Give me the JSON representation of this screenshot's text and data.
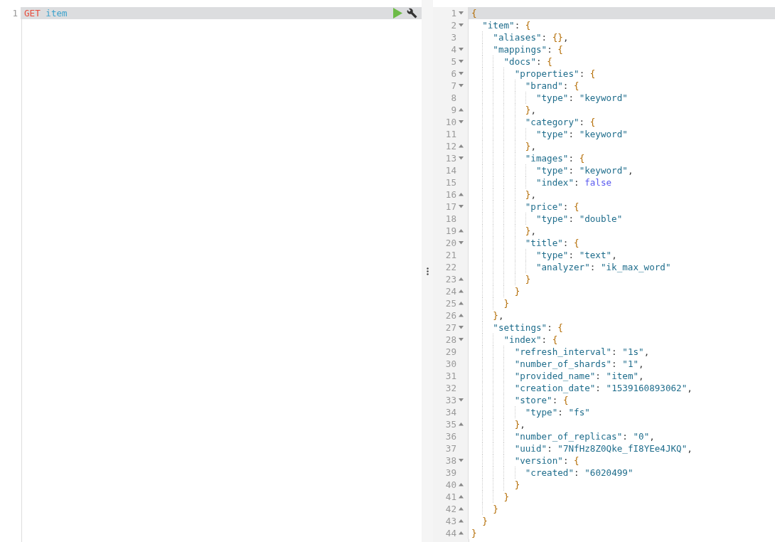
{
  "request_editor": {
    "lines": [
      {
        "number": "1",
        "method": "GET",
        "url": "item",
        "active": true
      }
    ]
  },
  "response_viewer": {
    "lines": [
      {
        "number": "1",
        "text": "{",
        "kind": "open",
        "active": true
      },
      {
        "number": "2",
        "text": "  \"item\": {",
        "kind": "open",
        "active": false
      },
      {
        "number": "3",
        "text": "    \"aliases\": {},",
        "kind": "plain",
        "active": false
      },
      {
        "number": "4",
        "text": "    \"mappings\": {",
        "kind": "open",
        "active": false
      },
      {
        "number": "5",
        "text": "      \"docs\": {",
        "kind": "open",
        "active": false
      },
      {
        "number": "6",
        "text": "        \"properties\": {",
        "kind": "open",
        "active": false
      },
      {
        "number": "7",
        "text": "          \"brand\": {",
        "kind": "open",
        "active": false
      },
      {
        "number": "8",
        "text": "            \"type\": \"keyword\"",
        "kind": "plain",
        "active": false
      },
      {
        "number": "9",
        "text": "          },",
        "kind": "close",
        "active": false
      },
      {
        "number": "10",
        "text": "          \"category\": {",
        "kind": "open",
        "active": false
      },
      {
        "number": "11",
        "text": "            \"type\": \"keyword\"",
        "kind": "plain",
        "active": false
      },
      {
        "number": "12",
        "text": "          },",
        "kind": "close",
        "active": false
      },
      {
        "number": "13",
        "text": "          \"images\": {",
        "kind": "open",
        "active": false
      },
      {
        "number": "14",
        "text": "            \"type\": \"keyword\",",
        "kind": "plain",
        "active": false
      },
      {
        "number": "15",
        "text": "            \"index\": false",
        "kind": "plain",
        "active": false
      },
      {
        "number": "16",
        "text": "          },",
        "kind": "close",
        "active": false
      },
      {
        "number": "17",
        "text": "          \"price\": {",
        "kind": "open",
        "active": false
      },
      {
        "number": "18",
        "text": "            \"type\": \"double\"",
        "kind": "plain",
        "active": false
      },
      {
        "number": "19",
        "text": "          },",
        "kind": "close",
        "active": false
      },
      {
        "number": "20",
        "text": "          \"title\": {",
        "kind": "open",
        "active": false
      },
      {
        "number": "21",
        "text": "            \"type\": \"text\",",
        "kind": "plain",
        "active": false
      },
      {
        "number": "22",
        "text": "            \"analyzer\": \"ik_max_word\"",
        "kind": "plain",
        "active": false
      },
      {
        "number": "23",
        "text": "          }",
        "kind": "close",
        "active": false
      },
      {
        "number": "24",
        "text": "        }",
        "kind": "close",
        "active": false
      },
      {
        "number": "25",
        "text": "      }",
        "kind": "close",
        "active": false
      },
      {
        "number": "26",
        "text": "    },",
        "kind": "close",
        "active": false
      },
      {
        "number": "27",
        "text": "    \"settings\": {",
        "kind": "open",
        "active": false
      },
      {
        "number": "28",
        "text": "      \"index\": {",
        "kind": "open",
        "active": false
      },
      {
        "number": "29",
        "text": "        \"refresh_interval\": \"1s\",",
        "kind": "plain",
        "active": false
      },
      {
        "number": "30",
        "text": "        \"number_of_shards\": \"1\",",
        "kind": "plain",
        "active": false
      },
      {
        "number": "31",
        "text": "        \"provided_name\": \"item\",",
        "kind": "plain",
        "active": false
      },
      {
        "number": "32",
        "text": "        \"creation_date\": \"1539160893062\",",
        "kind": "plain",
        "active": false
      },
      {
        "number": "33",
        "text": "        \"store\": {",
        "kind": "open",
        "active": false
      },
      {
        "number": "34",
        "text": "          \"type\": \"fs\"",
        "kind": "plain",
        "active": false
      },
      {
        "number": "35",
        "text": "        },",
        "kind": "close",
        "active": false
      },
      {
        "number": "36",
        "text": "        \"number_of_replicas\": \"0\",",
        "kind": "plain",
        "active": false
      },
      {
        "number": "37",
        "text": "        \"uuid\": \"7NfHz8Z0Qke_fI8YEe4JKQ\",",
        "kind": "plain",
        "active": false
      },
      {
        "number": "38",
        "text": "        \"version\": {",
        "kind": "open",
        "active": false
      },
      {
        "number": "39",
        "text": "          \"created\": \"6020499\"",
        "kind": "plain",
        "active": false
      },
      {
        "number": "40",
        "text": "        }",
        "kind": "close",
        "active": false
      },
      {
        "number": "41",
        "text": "      }",
        "kind": "close",
        "active": false
      },
      {
        "number": "42",
        "text": "    }",
        "kind": "close",
        "active": false
      },
      {
        "number": "43",
        "text": "  }",
        "kind": "close",
        "active": false
      },
      {
        "number": "44",
        "text": "}",
        "kind": "close",
        "active": false
      }
    ]
  }
}
